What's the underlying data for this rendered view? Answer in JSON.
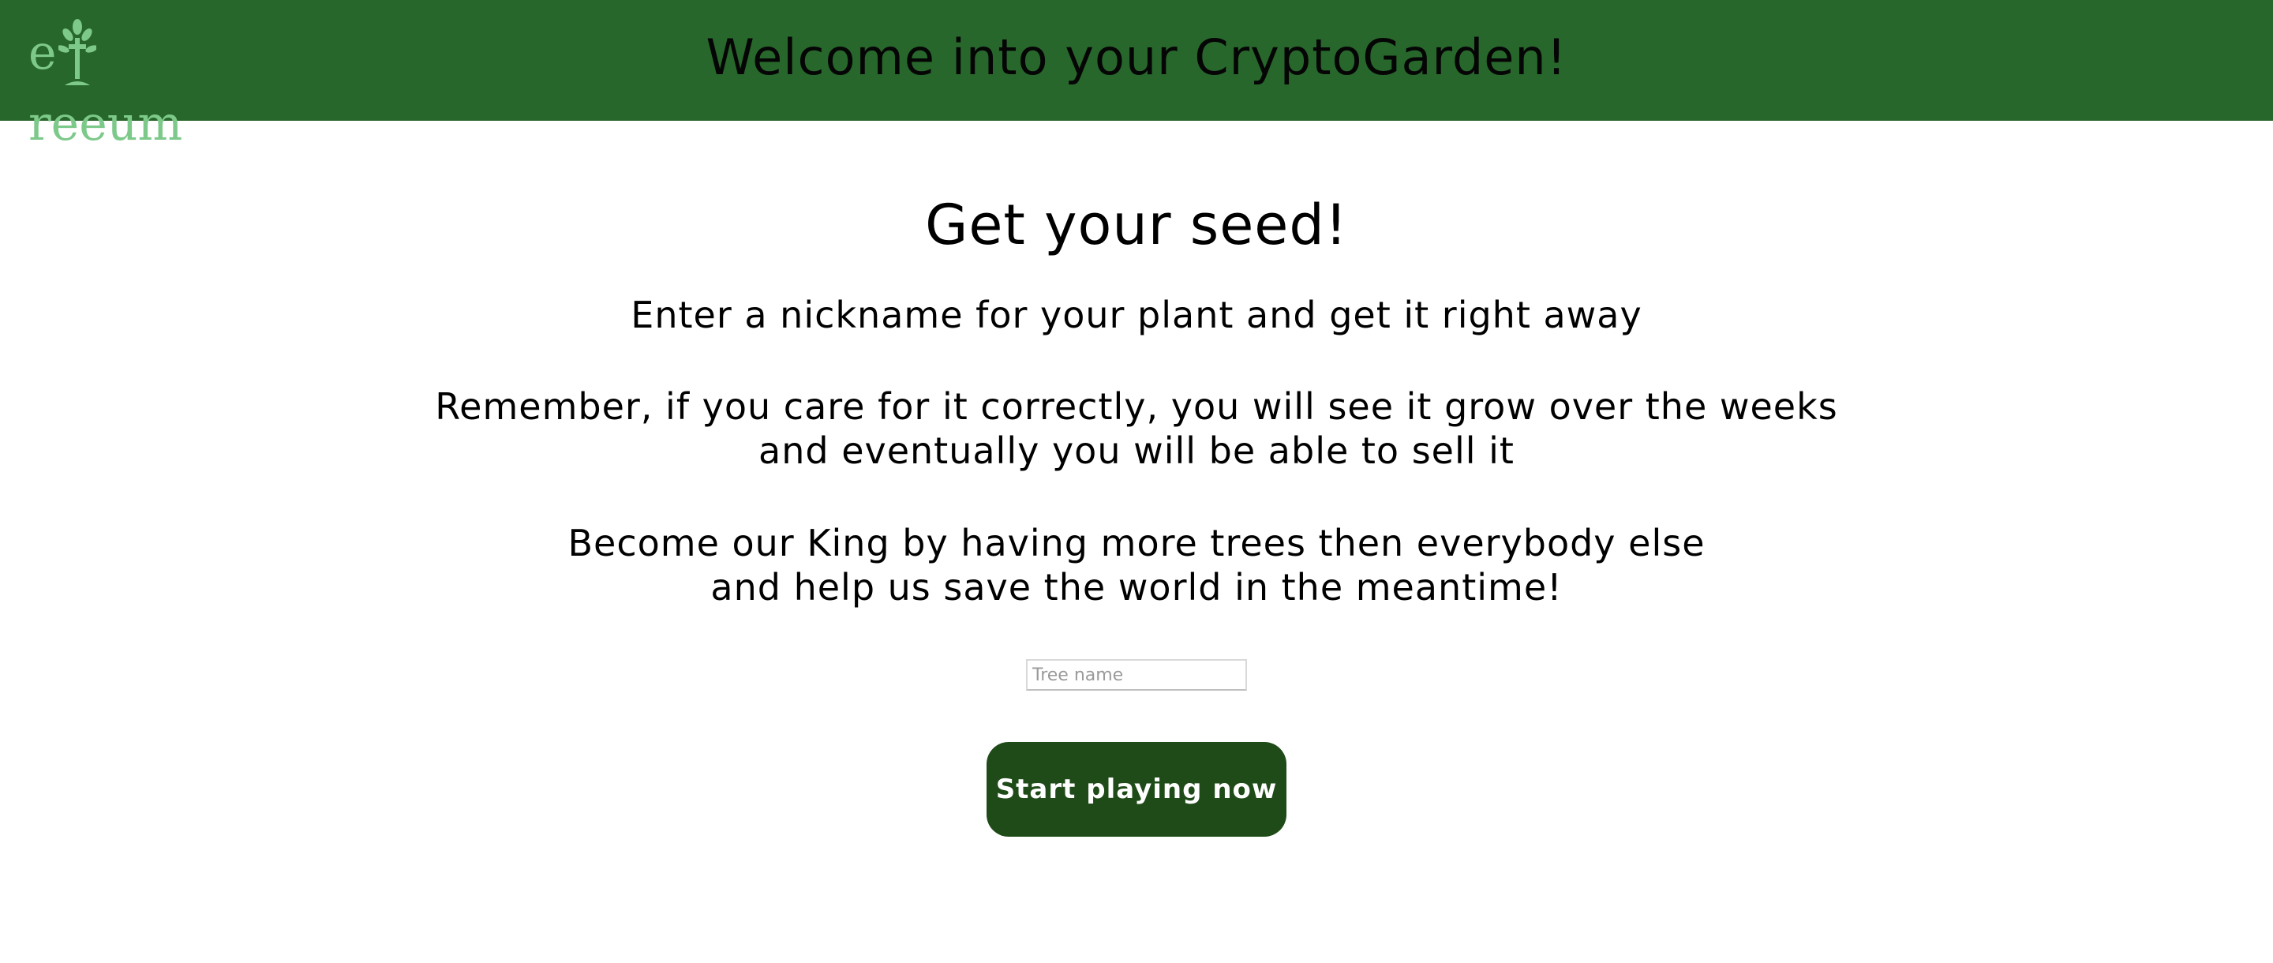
{
  "header": {
    "logo": {
      "letter_e": "e",
      "rest": "reeum",
      "icon": "tree-icon",
      "color": "#7dc98a"
    },
    "title": "Welcome into your CryptoGarden!",
    "background_color": "#28672c"
  },
  "main": {
    "heading": "Get your seed!",
    "paragraph1": "Enter a nickname for your plant and get it right away",
    "paragraph2_line1": "Remember, if you care for it correctly, you will see it grow over the weeks",
    "paragraph2_line2": "and eventually you will be able to sell it",
    "paragraph3_line1": "Become our King by having more trees then everybody else",
    "paragraph3_line2": "and help us save the world in the meantime!",
    "tree_name_input": {
      "value": "",
      "placeholder": "Tree name"
    },
    "start_button": {
      "label": "Start playing now",
      "color": "#1e4b17"
    }
  }
}
